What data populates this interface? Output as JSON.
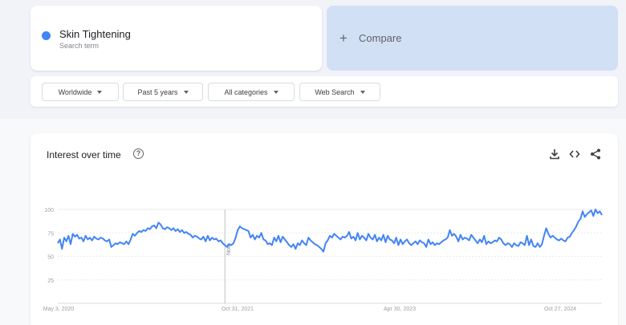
{
  "search_term": {
    "name": "Skin Tightening",
    "subtitle": "Search term",
    "color": "#4285f4"
  },
  "compare": {
    "plus": "+",
    "label": "Compare"
  },
  "filters": {
    "region": "Worldwide",
    "time_range": "Past 5 years",
    "category": "All categories",
    "search_type": "Web Search"
  },
  "chart_card": {
    "title": "Interest over time",
    "help_glyph": "?",
    "icons": [
      "download-icon",
      "embed-icon",
      "share-icon"
    ]
  },
  "chart_data": {
    "type": "line",
    "title": "Interest over time",
    "xlabel": "",
    "ylabel": "",
    "ylim": [
      0,
      100
    ],
    "y_ticks": [
      25,
      50,
      75,
      100
    ],
    "x_ticks": [
      "May 3, 2020",
      "Oct 31, 2021",
      "Apr 30, 2023",
      "Oct 27, 2024"
    ],
    "note": {
      "label": "Note",
      "at_week": 78
    },
    "grid": true,
    "line_color": "#4285f4",
    "series": [
      {
        "values": [
          64,
          68,
          58,
          70,
          66,
          72,
          63,
          74,
          71,
          73,
          69,
          70,
          66,
          72,
          68,
          70,
          67,
          71,
          69,
          68,
          70,
          69,
          67,
          66,
          68,
          60,
          62,
          64,
          63,
          65,
          64,
          63,
          66,
          63,
          68,
          74,
          72,
          75,
          77,
          76,
          78,
          77,
          80,
          79,
          82,
          83,
          80,
          86,
          84,
          80,
          79,
          81,
          80,
          78,
          80,
          77,
          79,
          76,
          78,
          75,
          76,
          74,
          73,
          70,
          72,
          71,
          69,
          68,
          71,
          66,
          72,
          67,
          70,
          68,
          69,
          66,
          67,
          64,
          62,
          60,
          63,
          62,
          64,
          70,
          78,
          82,
          80,
          79,
          78,
          77,
          70,
          73,
          68,
          72,
          70,
          75,
          68,
          67,
          63,
          64,
          62,
          70,
          66,
          72,
          65,
          71,
          68,
          65,
          62,
          60,
          63,
          58,
          64,
          62,
          67,
          64,
          62,
          70,
          67,
          65,
          63,
          62,
          60,
          58,
          55,
          64,
          67,
          72,
          70,
          74,
          72,
          70,
          68,
          71,
          70,
          72,
          76,
          69,
          71,
          67,
          75,
          68,
          72,
          70,
          67,
          74,
          70,
          68,
          73,
          66,
          70,
          67,
          73,
          65,
          72,
          68,
          67,
          64,
          70,
          62,
          68,
          63,
          66,
          68,
          64,
          62,
          64,
          66,
          63,
          67,
          65,
          64,
          60,
          68,
          63,
          65,
          62,
          64,
          63,
          65,
          67,
          68,
          70,
          78,
          72,
          74,
          71,
          66,
          73,
          68,
          70,
          69,
          67,
          73,
          70,
          67,
          64,
          68,
          65,
          72,
          63,
          66,
          64,
          65,
          67,
          66,
          70,
          68,
          64,
          62,
          64,
          63,
          60,
          64,
          62,
          61,
          65,
          64,
          62,
          72,
          62,
          68,
          61,
          60,
          64,
          60,
          63,
          72,
          80,
          74,
          70,
          72,
          70,
          68,
          67,
          69,
          67,
          66,
          70,
          71,
          75,
          78,
          82,
          87,
          90,
          98,
          92,
          95,
          97,
          99,
          93,
          100,
          96,
          98,
          94
        ]
      }
    ]
  }
}
